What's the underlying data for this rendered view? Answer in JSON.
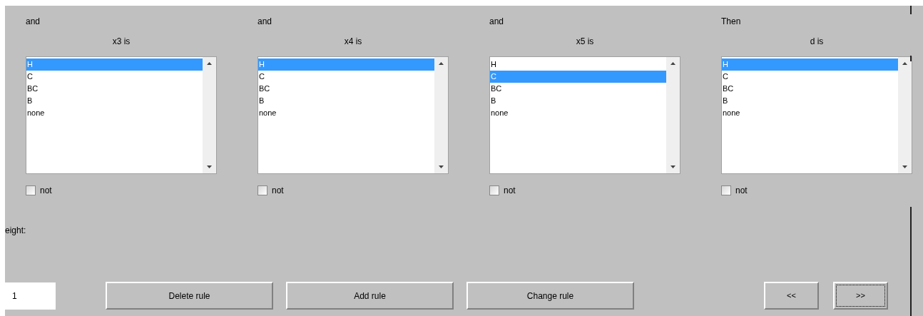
{
  "clauses": [
    {
      "connector": "and",
      "variable": "x3 is",
      "options": [
        {
          "label": "H",
          "selected": true
        },
        {
          "label": "C",
          "selected": false
        },
        {
          "label": "BC",
          "selected": false
        },
        {
          "label": "B",
          "selected": false
        },
        {
          "label": "none",
          "selected": false
        }
      ],
      "negate": {
        "label": "not",
        "checked": false
      }
    },
    {
      "connector": "and",
      "variable": "x4 is",
      "options": [
        {
          "label": "H",
          "selected": true
        },
        {
          "label": "C",
          "selected": false
        },
        {
          "label": "BC",
          "selected": false
        },
        {
          "label": "B",
          "selected": false
        },
        {
          "label": "none",
          "selected": false
        }
      ],
      "negate": {
        "label": "not",
        "checked": false
      }
    },
    {
      "connector": "and",
      "variable": "x5 is",
      "options": [
        {
          "label": "H",
          "selected": false
        },
        {
          "label": "C",
          "selected": true
        },
        {
          "label": "BC",
          "selected": false
        },
        {
          "label": "B",
          "selected": false
        },
        {
          "label": "none",
          "selected": false
        }
      ],
      "negate": {
        "label": "not",
        "checked": false
      }
    },
    {
      "connector": "Then",
      "variable": "d is",
      "options": [
        {
          "label": "H",
          "selected": true
        },
        {
          "label": "C",
          "selected": false
        },
        {
          "label": "BC",
          "selected": false
        },
        {
          "label": "B",
          "selected": false
        },
        {
          "label": "none",
          "selected": false
        }
      ],
      "negate": {
        "label": "not",
        "checked": false
      }
    }
  ],
  "weight": {
    "label": "eight:",
    "value": "1"
  },
  "actions": [
    "Delete rule",
    "Add rule",
    "Change rule"
  ],
  "navigation": [
    {
      "label": "<<",
      "focused": false
    },
    {
      "label": ">>",
      "focused": true
    }
  ]
}
